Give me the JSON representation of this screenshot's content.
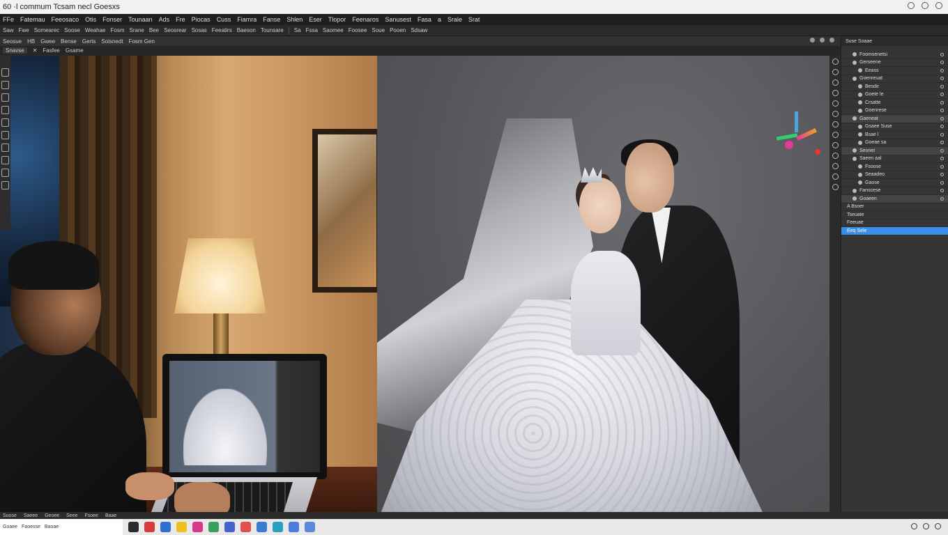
{
  "titlebar": {
    "title": "60 ·l commum  Tcsam necl Goesxs"
  },
  "menubar": {
    "items": [
      "FFe",
      "Fatemau",
      "Feeosaco",
      "Otis",
      "Fonser",
      "Tounaan",
      "Ads",
      "Fre",
      "Piocas",
      "Cuss",
      "Fiamra",
      "Fanse",
      "Shlen",
      "Eser",
      "Tlopor",
      "Feenaros",
      "Sanusest",
      "Fasa",
      "a",
      "Srale",
      "Srat"
    ]
  },
  "optbar": {
    "items": [
      "Saw",
      "Fwe",
      "Somearec",
      "Soose",
      "Weahae",
      "Fosm",
      "Srane",
      "Bee",
      "Seosrear",
      "Sosas",
      "Feeatirs",
      "Baeson",
      "Tounsare",
      "Sa",
      "Fssa",
      "Saomee",
      "Foosee",
      "Soue",
      "Pooen",
      "Sdsaw"
    ]
  },
  "tabbar": {
    "items": [
      "Seosue",
      "HB",
      "Gwee",
      "Bense",
      "Gerts",
      "Soisnedt",
      "Fosm Gen"
    ]
  },
  "doctabs": {
    "items": [
      "Snavse",
      "Fasfee",
      "Gsame"
    ]
  },
  "right_panel": {
    "header": "Suse Soaae",
    "layers": [
      {
        "label": "Foomsenetsi",
        "indent": 1,
        "state": "normal"
      },
      {
        "label": "Gerseene",
        "indent": 1,
        "state": "normal"
      },
      {
        "label": "Eeass",
        "indent": 2,
        "state": "normal"
      },
      {
        "label": "Goenreuat",
        "indent": 1,
        "state": "normal"
      },
      {
        "label": "Besde",
        "indent": 2,
        "state": "normal"
      },
      {
        "label": "Goete le",
        "indent": 2,
        "state": "normal"
      },
      {
        "label": "Crsatte",
        "indent": 2,
        "state": "normal"
      },
      {
        "label": "Goenrese",
        "indent": 2,
        "state": "normal"
      },
      {
        "label": "Gaeneat",
        "indent": 1,
        "state": "hl"
      },
      {
        "label": "Gsaee Suse",
        "indent": 2,
        "state": "normal"
      },
      {
        "label": "Bsae l",
        "indent": 2,
        "state": "normal"
      },
      {
        "label": "Goeae sa",
        "indent": 2,
        "state": "normal"
      },
      {
        "label": "Seoner",
        "indent": 1,
        "state": "hl"
      },
      {
        "label": "Saeen aal",
        "indent": 1,
        "state": "normal"
      },
      {
        "label": "Fsoose",
        "indent": 2,
        "state": "normal"
      },
      {
        "label": "Seaadeo",
        "indent": 2,
        "state": "normal"
      },
      {
        "label": "Gaose",
        "indent": 2,
        "state": "normal"
      },
      {
        "label": "Fanscese",
        "indent": 1,
        "state": "normal"
      },
      {
        "label": "Goaeen",
        "indent": 1,
        "state": "hl"
      },
      {
        "label": "A Bsoer",
        "indent": 0,
        "state": "normal"
      },
      {
        "label": "Tseuate",
        "indent": 0,
        "state": "normal"
      },
      {
        "label": "Feeuae",
        "indent": 0,
        "state": "normal"
      },
      {
        "label": "Eeq Sele",
        "indent": 0,
        "state": "sel"
      }
    ]
  },
  "statusbar": {
    "items": [
      "Suose",
      "Saeee",
      "Geoee",
      "Seee",
      "Fsoee",
      "Baae"
    ]
  },
  "taskbar": {
    "start_items": [
      "Goaee",
      "Faoesse",
      "Baoae"
    ]
  },
  "colors": {
    "selection": "#3a8ee6",
    "canvas_bg": "#575759",
    "panel_bg": "#353535"
  }
}
